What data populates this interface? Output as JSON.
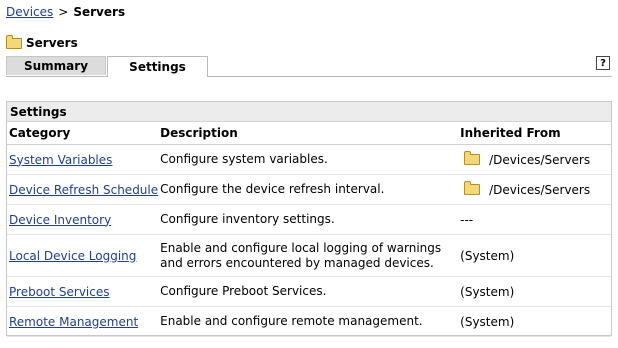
{
  "breadcrumb": {
    "devices": "Devices",
    "separator": ">",
    "current": "Servers"
  },
  "title": "Servers",
  "tabs": {
    "summary": "Summary",
    "settings": "Settings"
  },
  "help_label": "?",
  "panel": {
    "title": "Settings",
    "columns": {
      "category": "Category",
      "description": "Description",
      "inherited": "Inherited From"
    },
    "rows": [
      {
        "category": "System Variables",
        "description": "Configure system variables.",
        "inherited": "/Devices/Servers",
        "inherited_icon": "folder-icon"
      },
      {
        "category": "Device Refresh Schedule",
        "description": "Configure the device refresh interval.",
        "inherited": "/Devices/Servers",
        "inherited_icon": "folder-icon"
      },
      {
        "category": "Device Inventory",
        "description": "Configure inventory settings.",
        "inherited": "---"
      },
      {
        "category": "Local Device Logging",
        "description": "Enable and configure local logging of warnings and errors encountered by managed devices.",
        "inherited": "(System)"
      },
      {
        "category": "Preboot Services",
        "description": "Configure Preboot Services.",
        "inherited": "(System)"
      },
      {
        "category": "Remote Management",
        "description": "Enable and configure remote management.",
        "inherited": "(System)"
      }
    ]
  },
  "colors": {
    "link": "#1f3f8f",
    "folder": "#f3d878",
    "tab_inactive": "#dcdcdc",
    "panel_header": "#ececec"
  }
}
